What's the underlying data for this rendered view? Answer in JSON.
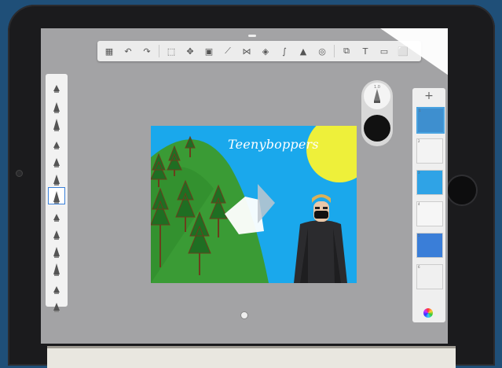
{
  "app": {
    "name": "Sketchbook drawing app on tablet"
  },
  "toolbar": {
    "items": [
      {
        "name": "gallery-icon",
        "glyph": "▦"
      },
      {
        "name": "undo-icon",
        "glyph": "↶"
      },
      {
        "name": "redo-icon",
        "glyph": "↷"
      },
      {
        "name": "select-icon",
        "glyph": "⬚"
      },
      {
        "name": "transform-icon",
        "glyph": "✥"
      },
      {
        "name": "layers-icon",
        "glyph": "▣"
      },
      {
        "name": "ruler-icon",
        "glyph": "⟋"
      },
      {
        "name": "symmetry-icon",
        "glyph": "⋈"
      },
      {
        "name": "fill-icon",
        "glyph": "◈"
      },
      {
        "name": "curve-icon",
        "glyph": "∫"
      },
      {
        "name": "image-icon",
        "glyph": "▲"
      },
      {
        "name": "perspective-icon",
        "glyph": "◎"
      },
      {
        "name": "copy-icon",
        "glyph": "⧉"
      },
      {
        "name": "text-icon",
        "glyph": "T"
      },
      {
        "name": "record-icon",
        "glyph": "▭"
      },
      {
        "name": "fullscreen-icon",
        "glyph": "⬜"
      }
    ]
  },
  "brushes": {
    "count": 14
  },
  "puck": {
    "size_label": "1.0",
    "color": "#111111"
  },
  "layers": {
    "add_label": "+",
    "thumbs": [
      {
        "num": "1",
        "bg": "#3e8fcf"
      },
      {
        "num": "2",
        "bg": "#f3f3f3"
      },
      {
        "num": "3",
        "bg": "#2fa3e6"
      },
      {
        "num": "4",
        "bg": "#f6f6f6"
      },
      {
        "num": "5",
        "bg": "#3a7ed8"
      },
      {
        "num": "6",
        "bg": "#f0f0f0"
      }
    ]
  },
  "artwork": {
    "title": "Teenyboppers",
    "sky_color": "#1aa8ec",
    "sun_color": "#eef03a",
    "hill_color": "#3a9b35"
  },
  "colors": {
    "accent": "#4aa3e0",
    "screen_bg": "#a3a3a5",
    "frame": "#1b1b1d"
  }
}
